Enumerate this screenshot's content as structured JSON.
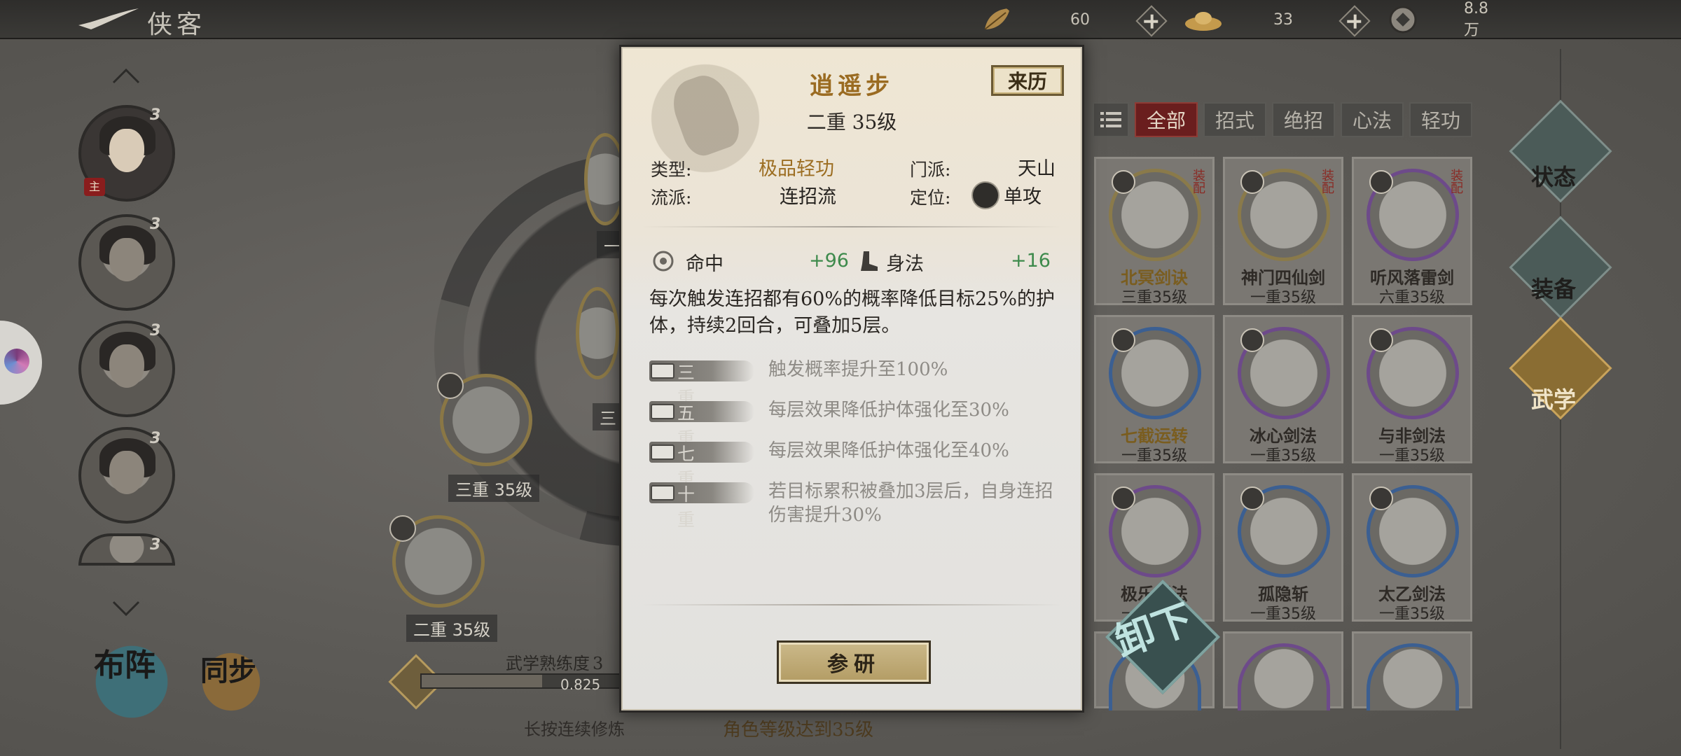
{
  "topbar": {
    "title": "侠客",
    "resources": [
      {
        "icon": "leaf-icon",
        "value": "60"
      },
      {
        "icon": "ingot-icon",
        "value": "33"
      },
      {
        "icon": "coin-icon",
        "value": "8.8万"
      }
    ]
  },
  "roster": {
    "stars": [
      "3",
      "3",
      "3",
      "3",
      "3"
    ],
    "main_tag": "主"
  },
  "bottom_buttons": {
    "formation": "布阵",
    "sync": "同步"
  },
  "center": {
    "node1_label": "三重 35级",
    "node2_label": "二重 35级",
    "node_left_cut1": "一",
    "node_left_cut2": "三",
    "mastery_title": "武学熟练度",
    "mastery_title_suffix": "3",
    "mastery_value": "0.825",
    "mastery_progress": 0.6,
    "hint": "长按连续修炼",
    "requirement": "角色等级达到35级"
  },
  "filters": [
    "全部",
    "招式",
    "绝招",
    "心法",
    "轻功"
  ],
  "filters_active": "全部",
  "cards": [
    {
      "name": "北冥剑诀",
      "level": "三重35级",
      "equipped": "装配",
      "ring": "gold",
      "gold": true
    },
    {
      "name": "神门四仙剑",
      "level": "一重35级",
      "equipped": "装配",
      "ring": "gold",
      "gold": false
    },
    {
      "name": "听风落雷剑",
      "level": "六重35级",
      "equipped": "装配",
      "ring": "purple",
      "gold": false
    },
    {
      "name": "七截运转",
      "level": "一重35级",
      "equipped": "",
      "ring": "blue",
      "gold": true
    },
    {
      "name": "冰心剑法",
      "level": "一重35级",
      "equipped": "",
      "ring": "purple",
      "gold": false
    },
    {
      "name": "与非剑法",
      "level": "一重35级",
      "equipped": "",
      "ring": "purple",
      "gold": false
    },
    {
      "name": "极乐剑法",
      "level": "一重35级",
      "equipped": "",
      "ring": "purple",
      "gold": false
    },
    {
      "name": "孤隐斩",
      "level": "一重35级",
      "equipped": "",
      "ring": "blue",
      "gold": false
    },
    {
      "name": "太乙剑法",
      "level": "一重35级",
      "equipped": "",
      "ring": "blue",
      "gold": false
    }
  ],
  "unequip_label": "卸下",
  "right_tabs": [
    "状态",
    "装备",
    "武学"
  ],
  "right_tab_active": "武学",
  "modal": {
    "title": "逍遥步",
    "level": "二重 35级",
    "origin_button": "来历",
    "type_label": "类型:",
    "type_value": "极品轻功",
    "sect_label": "门派:",
    "sect_value": "天山",
    "school_label": "流派:",
    "school_value": "连招流",
    "position_label": "定位:",
    "position_value": "单攻",
    "stats": [
      {
        "icon": "target-icon",
        "label": "命中",
        "value": "+96"
      },
      {
        "icon": "boot-icon",
        "label": "身法",
        "value": "+16"
      }
    ],
    "description": "每次触发连招都有60%的概率降低目标25%的护体，持续2回合，可叠加5层。",
    "tiers": [
      {
        "name": "三重",
        "desc": "触发概率提升至100%"
      },
      {
        "name": "五重",
        "desc": "每层效果降低护体强化至30%"
      },
      {
        "name": "七重",
        "desc": "每层效果降低护体强化至40%"
      },
      {
        "name": "十重",
        "desc": "若目标累积被叠加3层后，自身连招伤害提升30%"
      }
    ],
    "study_button": "参研"
  },
  "colors": {
    "accent_gold": "#9a6b21",
    "stat_green": "#3e8a4c",
    "filter_active": "#6a1e1e"
  }
}
